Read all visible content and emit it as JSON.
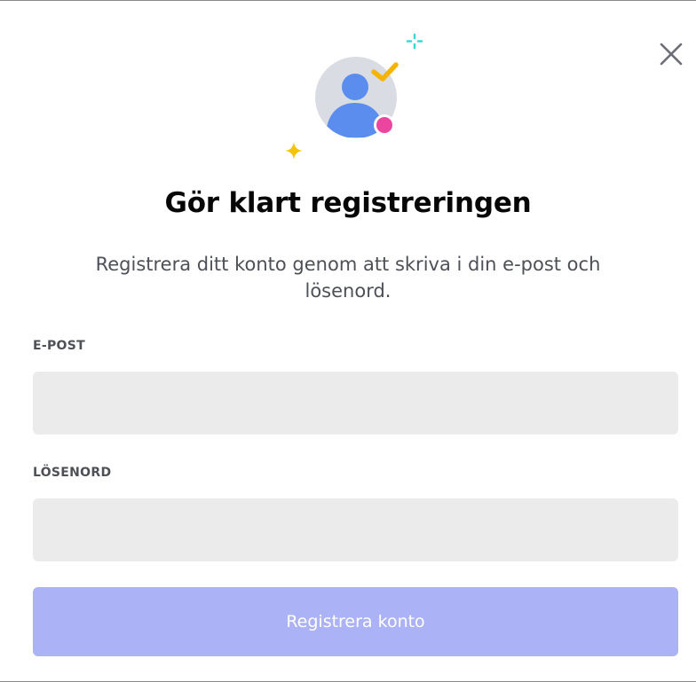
{
  "dialog": {
    "title": "Gör klart registreringen",
    "subtitle": "Registrera ditt konto genom att skriva i din e-post och lösenord."
  },
  "form": {
    "email": {
      "label": "E-POST",
      "value": "",
      "placeholder": ""
    },
    "password": {
      "label": "LÖSENORD",
      "value": "",
      "placeholder": ""
    },
    "submit_label": "Registrera konto",
    "submit_disabled": true
  },
  "icons": {
    "close": "close-icon",
    "illustration": "user-verified-illustration"
  },
  "colors": {
    "button_disabled": "#acb2f6",
    "input_background": "#ebebeb",
    "avatar_blue": "#5b8def",
    "avatar_circle": "#d9dce3",
    "check_yellow": "#f5b400",
    "status_pink": "#eb459f",
    "sparkle_teal": "#3ad8d5",
    "sparkle_yellow": "#f5c400"
  }
}
